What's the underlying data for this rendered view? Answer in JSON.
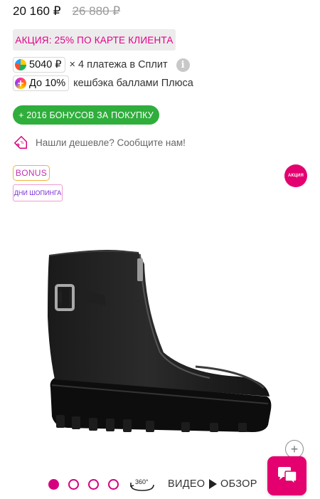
{
  "price": {
    "current": "20 160 ₽",
    "old": "26 880 ₽"
  },
  "promo": {
    "label": "АКЦИЯ: 25% ПО КАРТЕ КЛИЕНТА"
  },
  "split": {
    "amount": "5040 ₽",
    "text": "× 4 платежа в Сплит",
    "info_icon": "info-icon",
    "logo_icon": "split-logo-icon"
  },
  "cashback": {
    "amount": "До 10%",
    "text": "кешбэка баллами Плюса",
    "logo_icon": "plus-logo-icon"
  },
  "bonus_button": {
    "label": "+ 2016 БОНУСОВ ЗА ПОКУПКУ"
  },
  "cheaper": {
    "text": "Нашли дешевле? Сообщите нам!",
    "icon": "price-tag-icon"
  },
  "badges": {
    "bonus": "BONUS",
    "shopping_days": "ДНИ ШОПИНГА",
    "sale": "АКЦИЯ"
  },
  "gallery": {
    "dots": [
      {
        "active": true
      },
      {
        "active": false
      },
      {
        "active": false
      },
      {
        "active": false
      }
    ],
    "view360_label": "360°",
    "video_label": "ВИДЕО",
    "review_label": "ОБЗОР"
  },
  "colors": {
    "accent": "#e4006f",
    "green": "#2fae3c",
    "promo_text": "#e4008a"
  }
}
